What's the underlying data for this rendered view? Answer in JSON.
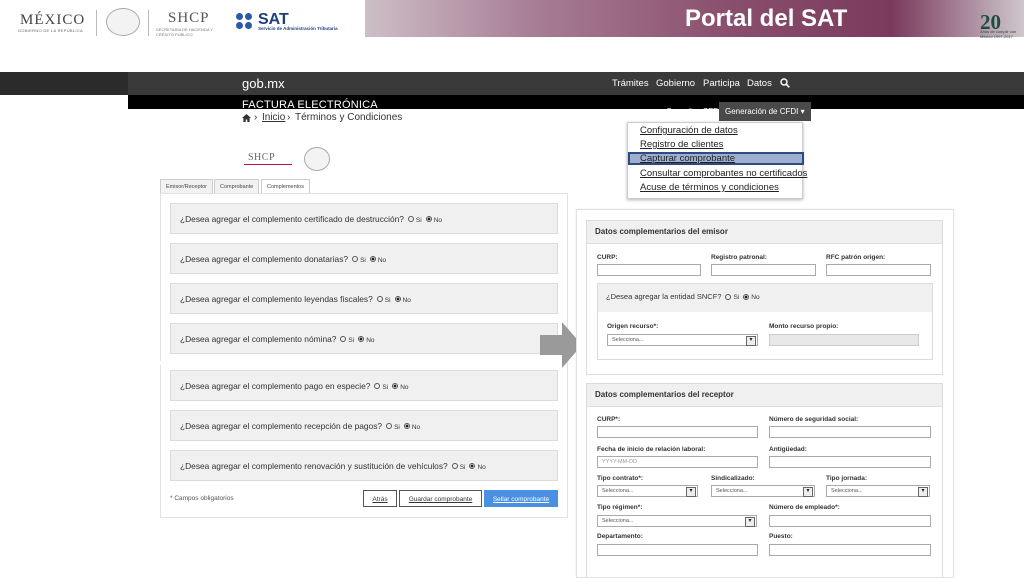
{
  "header": {
    "mexico_logo": "MÉXICO",
    "mexico_sub": "GOBIERNO DE LA REPÚBLICA",
    "shcp_logo": "SHCP",
    "shcp_sub": "SECRETARÍA DE HACIENDA Y CRÉDITO PÚBLICO",
    "sat_logo": "SAT",
    "sat_sub": "Servicio de Administración Tributaria",
    "portal_title": "Portal del SAT",
    "anniversary": "20",
    "anniversary_sub": "Años de cumplir con México 1997-2017"
  },
  "nav": {
    "brand": "gob.mx",
    "links": [
      "Trámites",
      "Gobierno",
      "Participa",
      "Datos"
    ],
    "section": "FACTURA ELECTRÓNICA",
    "subnav": [
      "Consultar CFD",
      "Generación de CFDI"
    ]
  },
  "dropdown": [
    "Configuración de datos",
    "Registro de clientes",
    "Capturar comprobante",
    "Consultar comprobantes no certificados",
    "Acuse de términos y condiciones"
  ],
  "breadcrumb": {
    "home": "Inicio",
    "current": "Términos y Condiciones"
  },
  "tabs": [
    "Emisor/Receptor",
    "Comprobante",
    "Complementos"
  ],
  "options": {
    "yes": "Si",
    "no": "No"
  },
  "questions": [
    "¿Desea agregar el complemento certificado de destrucción?",
    "¿Desea agregar el complemento donatarias?",
    "¿Desea agregar el complemento leyendas fiscales?",
    "¿Desea agregar el complemento nómina?",
    "¿Desea agregar el complemento pago en especie?",
    "¿Desea agregar el complemento recepción de pagos?",
    "¿Desea agregar el complemento renovación y sustitución de vehículos?"
  ],
  "form": {
    "required_note": "* Campos obligatorios",
    "back": "Atrás",
    "save": "Guardar comprobante",
    "seal": "Sellar comprobante"
  },
  "emisor": {
    "title": "Datos complementarios del emisor",
    "curp": "CURP:",
    "registro": "Registro patronal:",
    "rfc_origen": "RFC patrón origen:",
    "sncf_question": "¿Desea agregar la entidad SNCF?",
    "origen": "Origen recurso*:",
    "monto": "Monto recurso propio:",
    "select_placeholder": "Selecciona..."
  },
  "receptor": {
    "title": "Datos complementarios del receptor",
    "curp": "CURP*:",
    "nss": "Número de seguridad social:",
    "fecha": "Fecha de inicio de relación laboral:",
    "fecha_placeholder": "YYYY-MM-DD",
    "antiguedad": "Antigüedad:",
    "tipo_contrato": "Tipo contrato*:",
    "sindicalizado": "Sindicalizado:",
    "tipo_jornada": "Tipo jornada:",
    "tipo_regimen": "Tipo régimen*:",
    "num_empleado": "Número de empleado*:",
    "departamento": "Departamento:",
    "puesto": "Puesto:",
    "select_placeholder": "Selecciona..."
  }
}
